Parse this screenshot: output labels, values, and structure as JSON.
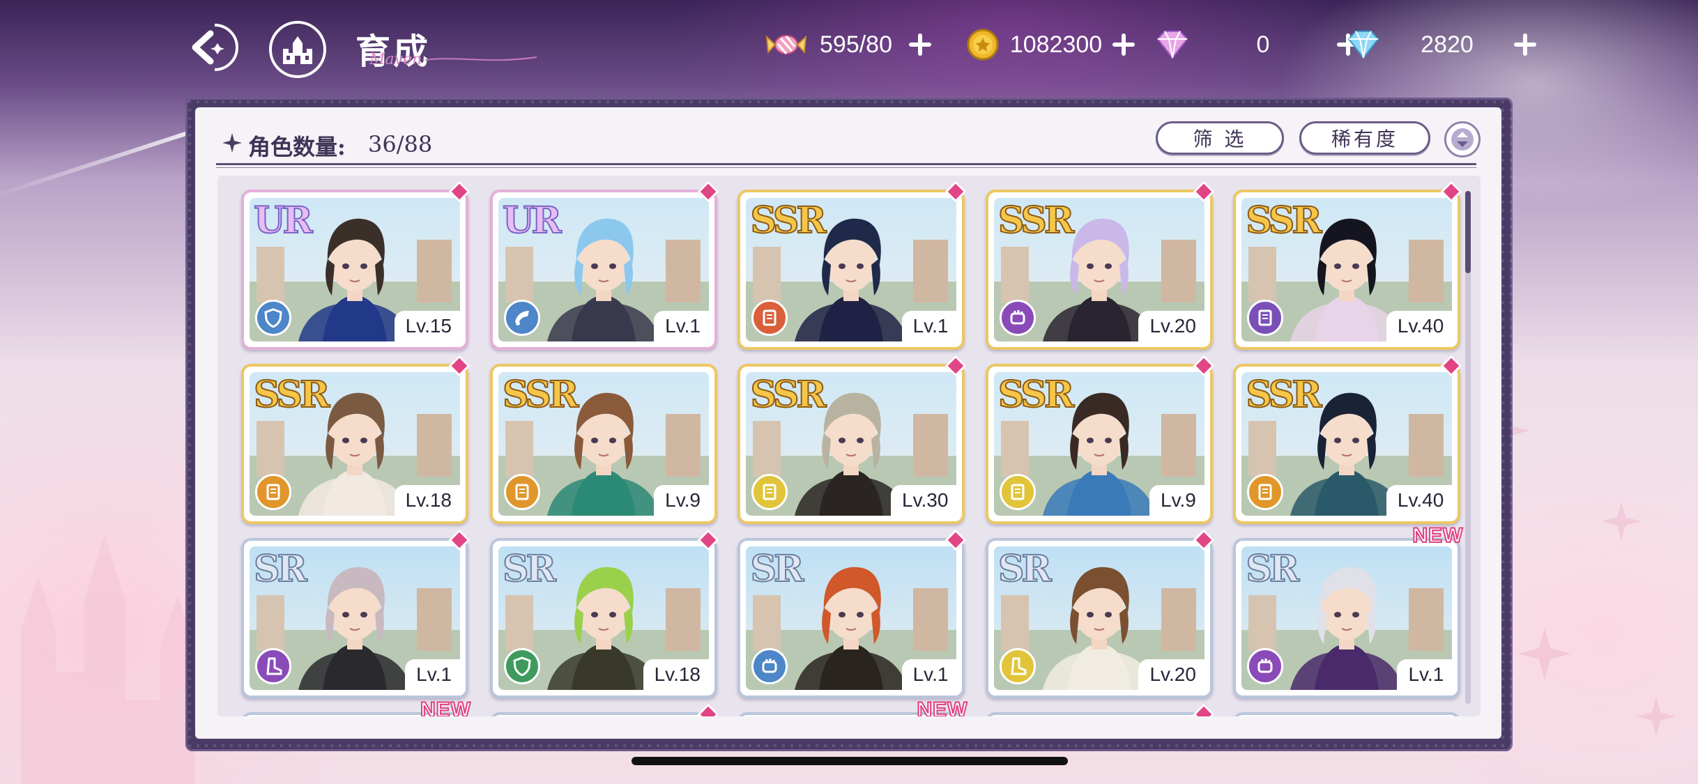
{
  "header": {
    "title": "育成",
    "title_script": "Maven"
  },
  "resources": [
    {
      "name": "candy",
      "icon": "candy-icon",
      "value": "595/80"
    },
    {
      "name": "gold",
      "icon": "coin-icon",
      "value": "1082300"
    },
    {
      "name": "pink-gem",
      "icon": "pink-gem-icon",
      "value": "0"
    },
    {
      "name": "blue-gem",
      "icon": "blue-gem-icon",
      "value": "2820"
    }
  ],
  "panel": {
    "count_label": "角色数量:",
    "count_value": "36/88",
    "filter_label": "筛 选",
    "sort_label": "稀有度"
  },
  "cards": [
    {
      "rarity": "UR",
      "level": "Lv.15",
      "type": "shield",
      "type_color": "#4d86c9",
      "gem": true,
      "is_new": false,
      "hair": "#3b2f2a",
      "outfit": "#223a8a"
    },
    {
      "rarity": "UR",
      "level": "Lv.1",
      "type": "horn",
      "type_color": "#4d86c9",
      "gem": true,
      "is_new": false,
      "hair": "#8cc8ee",
      "outfit": "#3a3a4e"
    },
    {
      "rarity": "SSR",
      "level": "Lv.1",
      "type": "book",
      "type_color": "#d9603a",
      "gem": true,
      "is_new": false,
      "hair": "#1f2a4a",
      "outfit": "#202244"
    },
    {
      "rarity": "SSR",
      "level": "Lv.20",
      "type": "fist",
      "type_color": "#8a4bb8",
      "gem": true,
      "is_new": false,
      "hair": "#c9b8e8",
      "outfit": "#2a2430"
    },
    {
      "rarity": "SSR",
      "level": "Lv.40",
      "type": "book",
      "type_color": "#7a50b8",
      "gem": true,
      "is_new": false,
      "hair": "#151520",
      "outfit": "#e7d3e8"
    },
    {
      "rarity": "SSR",
      "level": "Lv.18",
      "type": "book",
      "type_color": "#e0962a",
      "gem": true,
      "is_new": false,
      "hair": "#7a5a40",
      "outfit": "#f2e9e0"
    },
    {
      "rarity": "SSR",
      "level": "Lv.9",
      "type": "book",
      "type_color": "#e0962a",
      "gem": false,
      "is_new": false,
      "hair": "#8a5a3a",
      "outfit": "#2c8a76"
    },
    {
      "rarity": "SSR",
      "level": "Lv.30",
      "type": "book",
      "type_color": "#e2c43a",
      "gem": true,
      "is_new": false,
      "hair": "#b8b2a0",
      "outfit": "#2a2622"
    },
    {
      "rarity": "SSR",
      "level": "Lv.9",
      "type": "book",
      "type_color": "#e2c43a",
      "gem": true,
      "is_new": false,
      "hair": "#3a2a24",
      "outfit": "#3a7ab8"
    },
    {
      "rarity": "SSR",
      "level": "Lv.40",
      "type": "book",
      "type_color": "#e0962a",
      "gem": true,
      "is_new": false,
      "hair": "#1a2236",
      "outfit": "#2a5a6a"
    },
    {
      "rarity": "SR",
      "level": "Lv.1",
      "type": "boot",
      "type_color": "#8a4bb8",
      "gem": true,
      "is_new": false,
      "hair": "#c8b8c0",
      "outfit": "#2a2a2e"
    },
    {
      "rarity": "SR",
      "level": "Lv.18",
      "type": "shield",
      "type_color": "#3f9a5e",
      "gem": true,
      "is_new": false,
      "hair": "#9ad04a",
      "outfit": "#3a3a2a"
    },
    {
      "rarity": "SR",
      "level": "Lv.1",
      "type": "fist",
      "type_color": "#4d86c9",
      "gem": true,
      "is_new": false,
      "hair": "#d0582a",
      "outfit": "#2a2420"
    },
    {
      "rarity": "SR",
      "level": "Lv.20",
      "type": "boot",
      "type_color": "#e2c43a",
      "gem": true,
      "is_new": false,
      "hair": "#7a5030",
      "outfit": "#f0ece0"
    },
    {
      "rarity": "SR",
      "level": "Lv.1",
      "type": "fist",
      "type_color": "#8a4bb8",
      "gem": false,
      "is_new": true,
      "hair": "#e0e0e8",
      "outfit": "#4a2a6a"
    }
  ],
  "partial_row": [
    {
      "gem": false,
      "is_new": true
    },
    {
      "gem": true,
      "is_new": false
    },
    {
      "gem": false,
      "is_new": true
    },
    {
      "gem": true,
      "is_new": false
    },
    {
      "gem": false,
      "is_new": false
    }
  ],
  "new_label": "NEW"
}
